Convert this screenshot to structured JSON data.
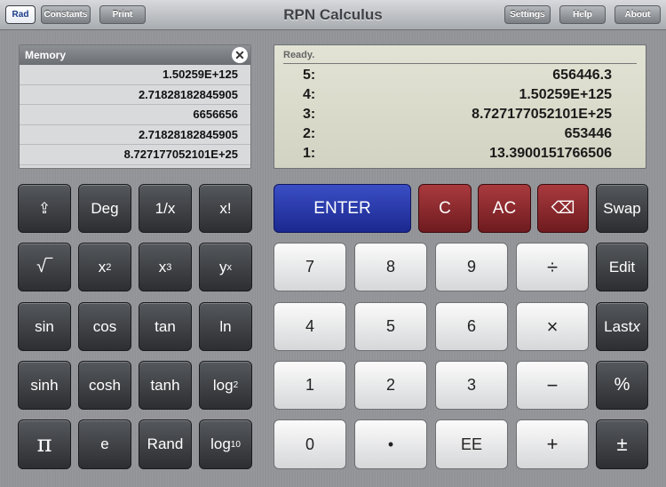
{
  "toolbar": {
    "rad": "Rad",
    "constants": "Constants",
    "print": "Print",
    "title": "RPN Calculus",
    "settings": "Settings",
    "help": "Help",
    "about": "About"
  },
  "memory": {
    "title": "Memory",
    "close_icon": "close-icon",
    "values": [
      "1.50259E+125",
      "2.71828182845905",
      "6656656",
      "2.71828182845905",
      "8.727177052101E+25"
    ]
  },
  "display": {
    "status": "Ready.",
    "stack": [
      {
        "label": "5:",
        "value": "656446.3"
      },
      {
        "label": "4:",
        "value": "1.50259E+125"
      },
      {
        "label": "3:",
        "value": "8.727177052101E+25"
      },
      {
        "label": "2:",
        "value": "653446"
      },
      {
        "label": "1:",
        "value": "13.3900151766506"
      }
    ]
  },
  "keys": {
    "shift": "⇪",
    "deg": "Deg",
    "reciprocal": "1/x",
    "factorial": "x!",
    "sqrt": "√‾",
    "x": "x",
    "sq_exp": "2",
    "cube_exp": "3",
    "y": "y",
    "pow_exp": "x",
    "sin": "sin",
    "cos": "cos",
    "tan": "tan",
    "ln": "ln",
    "sinh": "sinh",
    "cosh": "cosh",
    "tanh": "tanh",
    "log": "log",
    "log2_sub": "2",
    "log10_sub": "10",
    "pi": "π",
    "e": "e",
    "rand": "Rand",
    "enter": "ENTER",
    "clear": "C",
    "all_clear": "AC",
    "backspace": "⌫",
    "swap": "Swap",
    "edit": "Edit",
    "lastx_prefix": "Last",
    "lastx_var": "x",
    "percent": "%",
    "plus_minus": "±",
    "seven": "7",
    "eight": "8",
    "nine": "9",
    "divide": "÷",
    "four": "4",
    "five": "5",
    "six": "6",
    "multiply": "×",
    "one": "1",
    "two": "2",
    "three": "3",
    "minus": "−",
    "zero": "0",
    "dot": "•",
    "ee": "EE",
    "plus": "+"
  }
}
